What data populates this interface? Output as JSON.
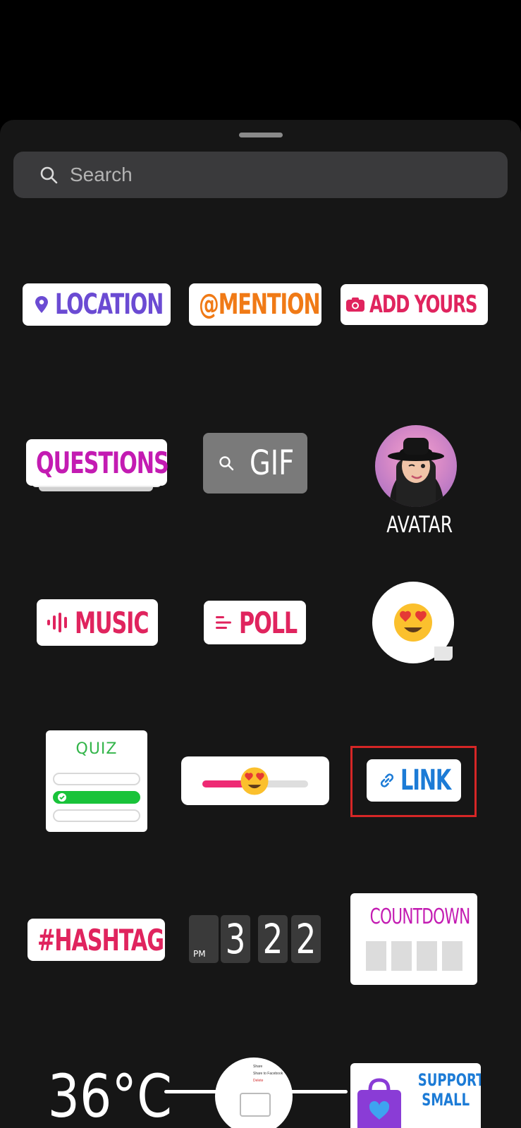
{
  "search": {
    "placeholder": "Search"
  },
  "stickers": {
    "location": "LOCATION",
    "mention": "@MENTION",
    "add_yours": "ADD YOURS",
    "questions": "QUESTIONS",
    "gif": "GIF",
    "avatar": "AVATAR",
    "music": "MUSIC",
    "poll": "POLL",
    "quiz": "QUIZ",
    "link": "LINK",
    "hashtag": "#HASHTAG",
    "countdown": "COUNTDOWN",
    "clock": {
      "ampm": "PM",
      "digits": [
        "3",
        "2",
        "2"
      ]
    },
    "temperature": "36°C",
    "support": [
      "SUPPORT",
      "SMALL"
    ]
  },
  "slider": {
    "fill_fraction": 0.45
  },
  "share_menu": [
    "Share",
    "Share to Facebook",
    "Delete"
  ],
  "colors": {
    "location": "#6b4bd3",
    "mention": "#f07a16",
    "add_yours": "#e0245e",
    "questions": "#c31bb2",
    "link": "#1c7bd6",
    "quiz": "#33b54a",
    "highlight_frame": "#d52626"
  },
  "icons": [
    "search-icon",
    "location-pin-icon",
    "camera-icon",
    "music-bars-icon",
    "poll-lines-icon",
    "link-chain-icon",
    "heart-eyes-emoji-icon",
    "check-icon",
    "shopping-bag-icon"
  ]
}
